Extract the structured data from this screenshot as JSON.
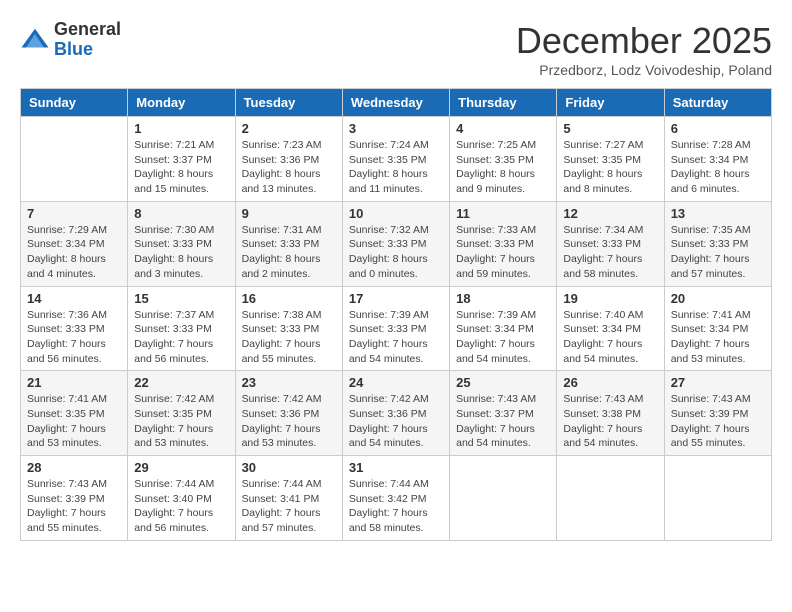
{
  "logo": {
    "general": "General",
    "blue": "Blue"
  },
  "title": "December 2025",
  "location": "Przedborz, Lodz Voivodeship, Poland",
  "days_of_week": [
    "Sunday",
    "Monday",
    "Tuesday",
    "Wednesday",
    "Thursday",
    "Friday",
    "Saturday"
  ],
  "weeks": [
    [
      {
        "day": "",
        "sunrise": "",
        "sunset": "",
        "daylight": ""
      },
      {
        "day": "1",
        "sunrise": "Sunrise: 7:21 AM",
        "sunset": "Sunset: 3:37 PM",
        "daylight": "Daylight: 8 hours and 15 minutes."
      },
      {
        "day": "2",
        "sunrise": "Sunrise: 7:23 AM",
        "sunset": "Sunset: 3:36 PM",
        "daylight": "Daylight: 8 hours and 13 minutes."
      },
      {
        "day": "3",
        "sunrise": "Sunrise: 7:24 AM",
        "sunset": "Sunset: 3:35 PM",
        "daylight": "Daylight: 8 hours and 11 minutes."
      },
      {
        "day": "4",
        "sunrise": "Sunrise: 7:25 AM",
        "sunset": "Sunset: 3:35 PM",
        "daylight": "Daylight: 8 hours and 9 minutes."
      },
      {
        "day": "5",
        "sunrise": "Sunrise: 7:27 AM",
        "sunset": "Sunset: 3:35 PM",
        "daylight": "Daylight: 8 hours and 8 minutes."
      },
      {
        "day": "6",
        "sunrise": "Sunrise: 7:28 AM",
        "sunset": "Sunset: 3:34 PM",
        "daylight": "Daylight: 8 hours and 6 minutes."
      }
    ],
    [
      {
        "day": "7",
        "sunrise": "Sunrise: 7:29 AM",
        "sunset": "Sunset: 3:34 PM",
        "daylight": "Daylight: 8 hours and 4 minutes."
      },
      {
        "day": "8",
        "sunrise": "Sunrise: 7:30 AM",
        "sunset": "Sunset: 3:33 PM",
        "daylight": "Daylight: 8 hours and 3 minutes."
      },
      {
        "day": "9",
        "sunrise": "Sunrise: 7:31 AM",
        "sunset": "Sunset: 3:33 PM",
        "daylight": "Daylight: 8 hours and 2 minutes."
      },
      {
        "day": "10",
        "sunrise": "Sunrise: 7:32 AM",
        "sunset": "Sunset: 3:33 PM",
        "daylight": "Daylight: 8 hours and 0 minutes."
      },
      {
        "day": "11",
        "sunrise": "Sunrise: 7:33 AM",
        "sunset": "Sunset: 3:33 PM",
        "daylight": "Daylight: 7 hours and 59 minutes."
      },
      {
        "day": "12",
        "sunrise": "Sunrise: 7:34 AM",
        "sunset": "Sunset: 3:33 PM",
        "daylight": "Daylight: 7 hours and 58 minutes."
      },
      {
        "day": "13",
        "sunrise": "Sunrise: 7:35 AM",
        "sunset": "Sunset: 3:33 PM",
        "daylight": "Daylight: 7 hours and 57 minutes."
      }
    ],
    [
      {
        "day": "14",
        "sunrise": "Sunrise: 7:36 AM",
        "sunset": "Sunset: 3:33 PM",
        "daylight": "Daylight: 7 hours and 56 minutes."
      },
      {
        "day": "15",
        "sunrise": "Sunrise: 7:37 AM",
        "sunset": "Sunset: 3:33 PM",
        "daylight": "Daylight: 7 hours and 56 minutes."
      },
      {
        "day": "16",
        "sunrise": "Sunrise: 7:38 AM",
        "sunset": "Sunset: 3:33 PM",
        "daylight": "Daylight: 7 hours and 55 minutes."
      },
      {
        "day": "17",
        "sunrise": "Sunrise: 7:39 AM",
        "sunset": "Sunset: 3:33 PM",
        "daylight": "Daylight: 7 hours and 54 minutes."
      },
      {
        "day": "18",
        "sunrise": "Sunrise: 7:39 AM",
        "sunset": "Sunset: 3:34 PM",
        "daylight": "Daylight: 7 hours and 54 minutes."
      },
      {
        "day": "19",
        "sunrise": "Sunrise: 7:40 AM",
        "sunset": "Sunset: 3:34 PM",
        "daylight": "Daylight: 7 hours and 54 minutes."
      },
      {
        "day": "20",
        "sunrise": "Sunrise: 7:41 AM",
        "sunset": "Sunset: 3:34 PM",
        "daylight": "Daylight: 7 hours and 53 minutes."
      }
    ],
    [
      {
        "day": "21",
        "sunrise": "Sunrise: 7:41 AM",
        "sunset": "Sunset: 3:35 PM",
        "daylight": "Daylight: 7 hours and 53 minutes."
      },
      {
        "day": "22",
        "sunrise": "Sunrise: 7:42 AM",
        "sunset": "Sunset: 3:35 PM",
        "daylight": "Daylight: 7 hours and 53 minutes."
      },
      {
        "day": "23",
        "sunrise": "Sunrise: 7:42 AM",
        "sunset": "Sunset: 3:36 PM",
        "daylight": "Daylight: 7 hours and 53 minutes."
      },
      {
        "day": "24",
        "sunrise": "Sunrise: 7:42 AM",
        "sunset": "Sunset: 3:36 PM",
        "daylight": "Daylight: 7 hours and 54 minutes."
      },
      {
        "day": "25",
        "sunrise": "Sunrise: 7:43 AM",
        "sunset": "Sunset: 3:37 PM",
        "daylight": "Daylight: 7 hours and 54 minutes."
      },
      {
        "day": "26",
        "sunrise": "Sunrise: 7:43 AM",
        "sunset": "Sunset: 3:38 PM",
        "daylight": "Daylight: 7 hours and 54 minutes."
      },
      {
        "day": "27",
        "sunrise": "Sunrise: 7:43 AM",
        "sunset": "Sunset: 3:39 PM",
        "daylight": "Daylight: 7 hours and 55 minutes."
      }
    ],
    [
      {
        "day": "28",
        "sunrise": "Sunrise: 7:43 AM",
        "sunset": "Sunset: 3:39 PM",
        "daylight": "Daylight: 7 hours and 55 minutes."
      },
      {
        "day": "29",
        "sunrise": "Sunrise: 7:44 AM",
        "sunset": "Sunset: 3:40 PM",
        "daylight": "Daylight: 7 hours and 56 minutes."
      },
      {
        "day": "30",
        "sunrise": "Sunrise: 7:44 AM",
        "sunset": "Sunset: 3:41 PM",
        "daylight": "Daylight: 7 hours and 57 minutes."
      },
      {
        "day": "31",
        "sunrise": "Sunrise: 7:44 AM",
        "sunset": "Sunset: 3:42 PM",
        "daylight": "Daylight: 7 hours and 58 minutes."
      },
      {
        "day": "",
        "sunrise": "",
        "sunset": "",
        "daylight": ""
      },
      {
        "day": "",
        "sunrise": "",
        "sunset": "",
        "daylight": ""
      },
      {
        "day": "",
        "sunrise": "",
        "sunset": "",
        "daylight": ""
      }
    ]
  ]
}
